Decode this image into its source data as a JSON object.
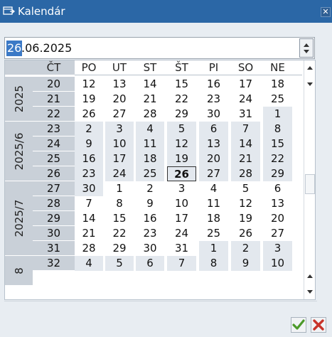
{
  "window": {
    "title": "Kalendár"
  },
  "date_input": {
    "selected_part": "26",
    "rest": ".06.2025"
  },
  "calendar": {
    "headers": [
      "ČT",
      "PO",
      "UT",
      "ST",
      "ŠT",
      "PI",
      "SO",
      "NE"
    ],
    "month_labels": [
      "2025",
      "2025/6",
      "2025/7",
      "8"
    ],
    "weeks": [
      {
        "wk": "20",
        "days": [
          "12",
          "13",
          "14",
          "15",
          "16",
          "17",
          "18"
        ]
      },
      {
        "wk": "21",
        "days": [
          "19",
          "20",
          "21",
          "22",
          "23",
          "24",
          "25"
        ]
      },
      {
        "wk": "22",
        "days": [
          "26",
          "27",
          "28",
          "29",
          "30",
          "31",
          "1"
        ]
      },
      {
        "wk": "23",
        "days": [
          "2",
          "3",
          "4",
          "5",
          "6",
          "7",
          "8"
        ]
      },
      {
        "wk": "24",
        "days": [
          "9",
          "10",
          "11",
          "12",
          "13",
          "14",
          "15"
        ]
      },
      {
        "wk": "25",
        "days": [
          "16",
          "17",
          "18",
          "19",
          "20",
          "21",
          "22"
        ]
      },
      {
        "wk": "26",
        "days": [
          "23",
          "24",
          "25",
          "26",
          "27",
          "28",
          "29"
        ]
      },
      {
        "wk": "27",
        "days": [
          "30",
          "1",
          "2",
          "3",
          "4",
          "5",
          "6"
        ]
      },
      {
        "wk": "28",
        "days": [
          "7",
          "8",
          "9",
          "10",
          "11",
          "12",
          "13"
        ]
      },
      {
        "wk": "29",
        "days": [
          "14",
          "15",
          "16",
          "17",
          "18",
          "19",
          "20"
        ]
      },
      {
        "wk": "30",
        "days": [
          "21",
          "22",
          "23",
          "24",
          "25",
          "26",
          "27"
        ]
      },
      {
        "wk": "31",
        "days": [
          "28",
          "29",
          "30",
          "31",
          "1",
          "2",
          "3"
        ]
      },
      {
        "wk": "32",
        "days": [
          "4",
          "5",
          "6",
          "7",
          "8",
          "9",
          "10"
        ]
      }
    ]
  },
  "icons": {
    "title": "window-icon",
    "close": "close-icon",
    "ok": "checkmark-icon",
    "cancel": "cancel-icon"
  },
  "colors": {
    "titlebar": "#2b67a6",
    "selection": "#3b79c6",
    "week_column": "#c9d0d8",
    "shaded_month": "#e3e8ee",
    "ok_green": "#4c9a2a",
    "cancel_red": "#c8342a"
  }
}
